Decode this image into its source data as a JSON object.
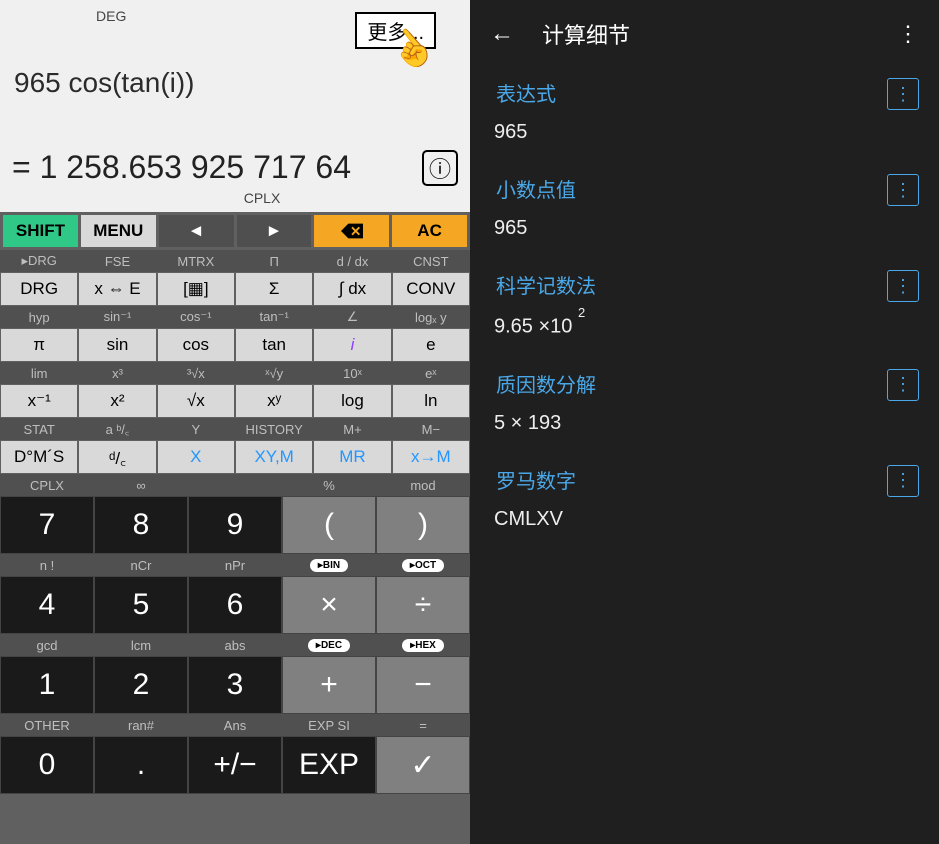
{
  "calc": {
    "deg_label": "DEG",
    "more_btn": "更多...",
    "expression": "965 cos(tan(i))",
    "result": "= 1 258.653 925 717 64",
    "cplx_label": "CPLX",
    "top_row": {
      "shift": "SHIFT",
      "menu": "MENU",
      "left": "◄",
      "right": "►",
      "backspace_icon": "⌫",
      "ac": "AC"
    },
    "shift_labels_1": [
      "▸DRG",
      "FSE",
      "MTRX",
      "Π",
      "d / dx",
      "CNST"
    ],
    "fn_row_1": [
      "DRG",
      "x ⇔ E",
      "[▦]",
      "Σ",
      "∫ dx",
      "CONV"
    ],
    "shift_labels_2": [
      "hyp",
      "sin⁻¹",
      "cos⁻¹",
      "tan⁻¹",
      "∠",
      "logₓ y"
    ],
    "fn_row_2": [
      "π",
      "sin",
      "cos",
      "tan",
      "i",
      "e"
    ],
    "shift_labels_3": [
      "lim",
      "x³",
      "³√x",
      "ˣ√y",
      "10ˣ",
      "eˣ"
    ],
    "fn_row_3": [
      "x⁻¹",
      "x²",
      "√x",
      "xʸ",
      "log",
      "ln"
    ],
    "shift_labels_4": [
      "STAT",
      "a ᵇ/꜀",
      "Y",
      "HISTORY",
      "M+",
      "M−"
    ],
    "fn_row_4": [
      "D°M´S",
      "ᵈ/꜀",
      "X",
      "XY,M",
      "MR",
      "x→M"
    ],
    "num_labels_1": [
      "CPLX",
      "∞",
      "",
      "%",
      "mod"
    ],
    "num_row_1": [
      "7",
      "8",
      "9",
      "(",
      ")"
    ],
    "num_labels_2": [
      "n !",
      "nCr",
      "nPr",
      "▸BIN",
      "▸OCT"
    ],
    "num_row_2": [
      "4",
      "5",
      "6",
      "×",
      "÷"
    ],
    "num_labels_3": [
      "gcd",
      "lcm",
      "abs",
      "▸DEC",
      "▸HEX"
    ],
    "num_row_3": [
      "1",
      "2",
      "3",
      "+",
      "−"
    ],
    "num_labels_4": [
      "OTHER",
      "ran#",
      "Ans",
      "EXP SI",
      "="
    ],
    "num_row_4": [
      "0",
      ".",
      "+/−",
      "EXP",
      "✓"
    ]
  },
  "details": {
    "title": "计算细节",
    "sections": {
      "expr": {
        "label": "表达式",
        "value": "965"
      },
      "decimal": {
        "label": "小数点值",
        "value": "965"
      },
      "sci": {
        "label": "科学记数法",
        "value_base": "9.65 ×10 ",
        "value_exp": "2"
      },
      "prime": {
        "label": "质因数分解",
        "value": "5 × 193"
      },
      "roman": {
        "label": "罗马数字",
        "value": "CMLXV"
      }
    }
  }
}
